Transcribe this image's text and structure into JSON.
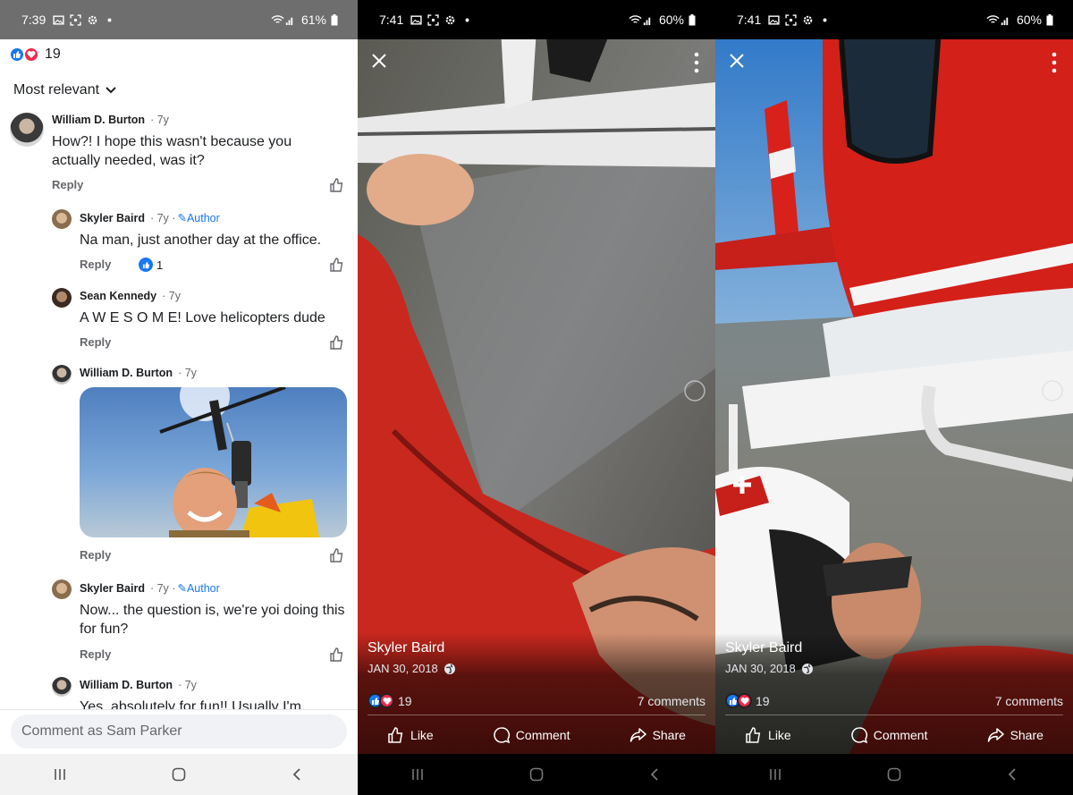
{
  "panel_comments": {
    "status": {
      "time": "7:39",
      "battery": "61%"
    },
    "reactions": {
      "count": "19"
    },
    "sort_label": "Most relevant",
    "comments": [
      {
        "name": "William D. Burton",
        "ago": "· 7y",
        "text": "How?! I hope this wasn't because you actually needed, was it?",
        "reply": "Reply"
      },
      {
        "name": "Skyler Baird",
        "ago": "· 7y ·",
        "author": "Author",
        "text": "Na man, just another day at the office.",
        "reply": "Reply",
        "likes": "1"
      },
      {
        "name": "Sean Kennedy",
        "ago": "· 7y",
        "text": "A W E S O M E!   Love helicopters dude",
        "reply": "Reply"
      },
      {
        "name": "William D. Burton",
        "ago": "· 7y",
        "reply": "Reply"
      },
      {
        "name": "Skyler Baird",
        "ago": "· 7y ·",
        "author": "Author",
        "text": "Now... the question is, we're yoi doing this for fun?",
        "reply": "Reply"
      },
      {
        "name": "William D. Burton",
        "ago": "· 7y",
        "text": "Yes, absolutely for fun!! Usually I'm"
      }
    ],
    "composer_placeholder": "Comment as Sam Parker"
  },
  "panel_photo_1": {
    "status": {
      "time": "7:41",
      "battery": "60%"
    },
    "author": "Skyler Baird",
    "date": "JAN 30, 2018",
    "reaction_count": "19",
    "comments": "7 comments",
    "actions": {
      "like": "Like",
      "comment": "Comment",
      "share": "Share"
    }
  },
  "panel_photo_2": {
    "status": {
      "time": "7:41",
      "battery": "60%"
    },
    "author": "Skyler Baird",
    "date": "JAN 30, 2018",
    "reaction_count": "19",
    "comments": "7 comments",
    "actions": {
      "like": "Like",
      "comment": "Comment",
      "share": "Share"
    }
  },
  "colors": {
    "facebook_blue": "#1877f2",
    "love_red": "#f0284a",
    "suit_red": "#c8281e"
  }
}
